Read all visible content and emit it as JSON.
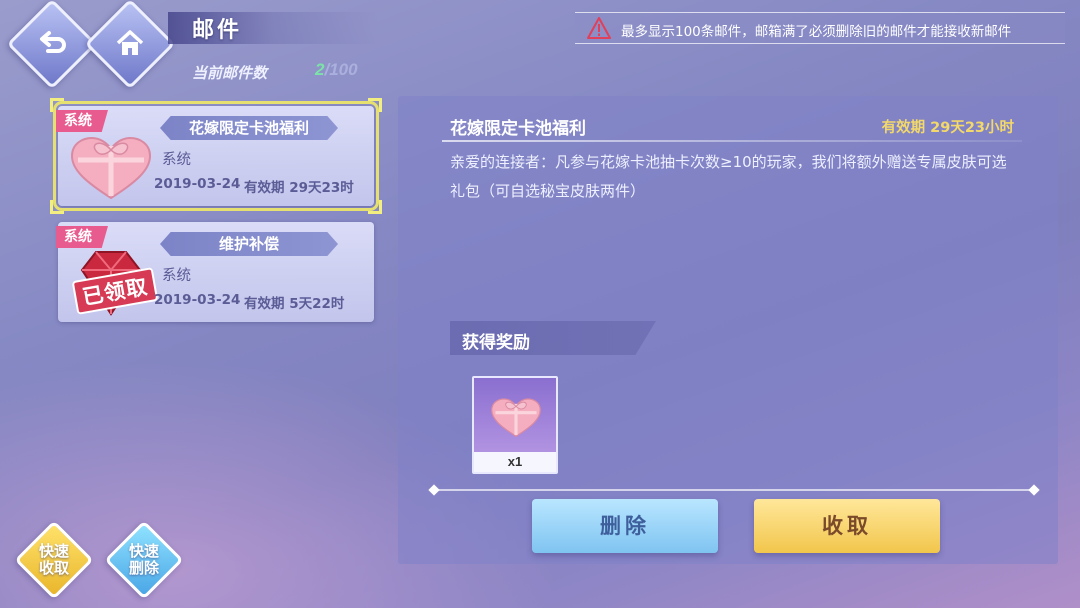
{
  "header": {
    "title": "邮件",
    "count_label": "当前邮件数",
    "count_current": "2",
    "count_max": "/100",
    "notice": "最多显示100条邮件，邮箱满了必须删除旧的邮件才能接收新邮件"
  },
  "mails": [
    {
      "tag": "系统",
      "subject": "花嫁限定卡池福利",
      "sender": "系统",
      "date": "2019-03-24",
      "expiry": "有效期 29天23时",
      "icon": "heart-gift-box",
      "selected": true
    },
    {
      "tag": "系统",
      "subject": "维护补偿",
      "sender": "系统",
      "date": "2019-03-24",
      "expiry": "有效期 5天22时",
      "icon": "red-gem",
      "stamp": "已领取"
    }
  ],
  "quick_buttons": {
    "collect": "快速收取",
    "delete": "快速删除"
  },
  "detail": {
    "title": "花嫁限定卡池福利",
    "validity": "有效期 29天23小时",
    "body": "亲爱的连接者：凡参与花嫁卡池抽卡次数≥10的玩家，我们将额外赠送专属皮肤可选礼包（可自选秘宝皮肤两件）",
    "rewards_title": "获得奖励",
    "rewards": [
      {
        "icon": "heart-gift-box",
        "qty": "x1"
      }
    ],
    "delete_label": "删除",
    "collect_label": "收取"
  },
  "colors": {
    "accent_gold": "#f3d86a",
    "tag_pink": "#e85b8e",
    "count_green": "#7ce3a8"
  }
}
